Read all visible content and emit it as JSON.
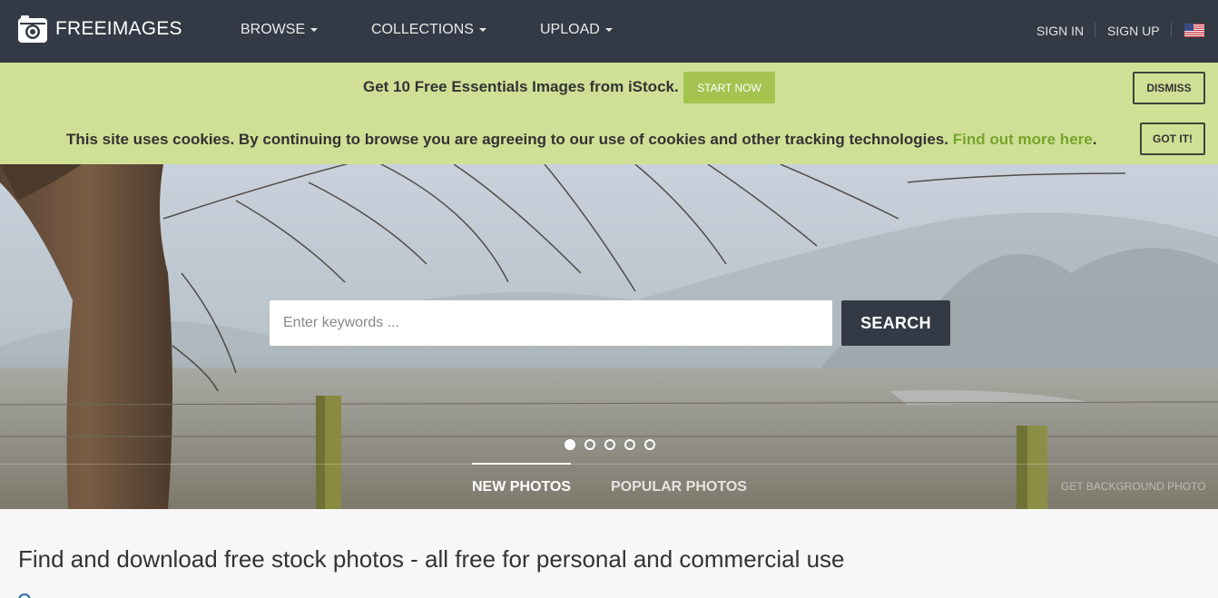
{
  "nav": {
    "brand": "FREEIMAGES",
    "menu": [
      "BROWSE",
      "COLLECTIONS",
      "UPLOAD"
    ],
    "sign_in": "SIGN IN",
    "sign_up": "SIGN UP"
  },
  "promo": {
    "text": "Get 10 Free Essentials Images from iStock.",
    "cta": "START NOW",
    "dismiss": "DISMISS"
  },
  "cookie": {
    "text": "This site uses cookies. By continuing to browse you are agreeing to our use of cookies and other tracking technologies.",
    "link": "Find out more here",
    "suffix": ".",
    "button": "GOT IT!"
  },
  "hero": {
    "search_placeholder": "Enter keywords ...",
    "search_button": "SEARCH",
    "slides": 5,
    "active_slide": 1,
    "tabs": [
      "NEW PHOTOS",
      "POPULAR PHOTOS"
    ],
    "active_tab": "NEW PHOTOS",
    "bg_link": "GET BACKGROUND PHOTO"
  },
  "main": {
    "headline": "Find and download free stock photos - all free for personal and commercial use"
  },
  "colors": {
    "nav_bg": "#343a45",
    "banner_bg": "#cfe096",
    "accent_green": "#a5c34f",
    "link_green": "#78a32c"
  }
}
